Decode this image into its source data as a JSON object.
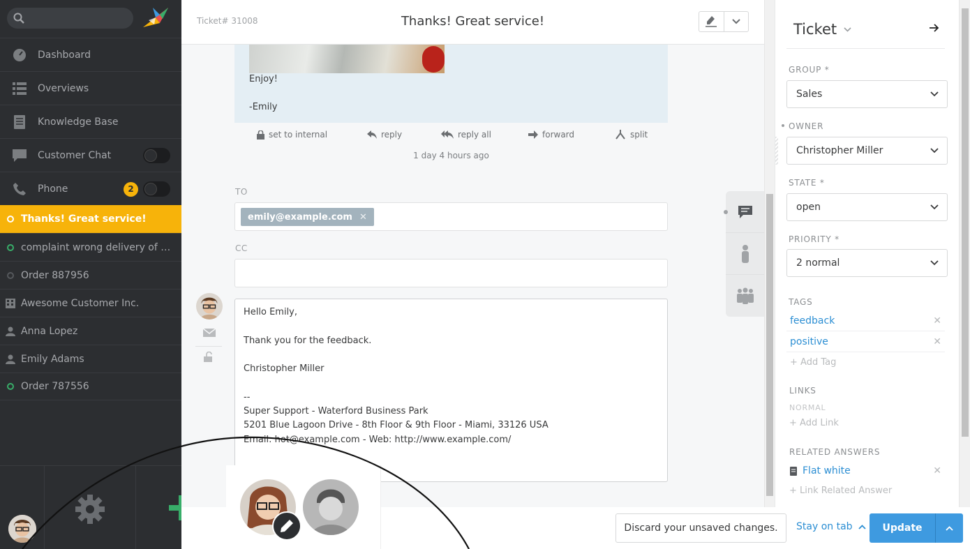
{
  "nav": {
    "items": [
      {
        "label": "Dashboard",
        "icon": "dashboard-icon"
      },
      {
        "label": "Overviews",
        "icon": "list-icon"
      },
      {
        "label": "Knowledge Base",
        "icon": "book-icon"
      },
      {
        "label": "Customer Chat",
        "icon": "chat-icon"
      },
      {
        "label": "Phone",
        "icon": "phone-icon",
        "badge": "2"
      }
    ],
    "tasks": [
      {
        "label": "Thanks! Great service!",
        "icon": "ticket-open-icon",
        "active": true
      },
      {
        "label": "complaint wrong delivery of ord...",
        "icon": "ticket-open-icon"
      },
      {
        "label": "Order 887956",
        "icon": "ticket-closed-icon"
      },
      {
        "label": "Awesome Customer Inc.",
        "icon": "organization-icon"
      },
      {
        "label": "Anna Lopez",
        "icon": "user-icon"
      },
      {
        "label": "Emily Adams",
        "icon": "user-icon"
      },
      {
        "label": "Order 787556",
        "icon": "ticket-open-icon"
      }
    ]
  },
  "ticket": {
    "number": "Ticket# 31008",
    "title": "Thanks! Great service!",
    "article": {
      "line1": "Enjoy!",
      "line2": "-Emily",
      "actions": [
        "set to internal",
        "reply",
        "reply all",
        "forward",
        "split"
      ],
      "time": "1 day 4 hours ago"
    },
    "reply": {
      "to_label": "TO",
      "to_value": "emily@example.com",
      "cc_label": "CC",
      "body": [
        "Hello Emily,",
        "Thank you for the feedback.",
        "Christopher Miller",
        "--",
        "Super Support - Waterford Business Park",
        "5201 Blue Lagoon Drive - 8th Floor & 9th Floor - Miami, 33126 USA",
        "Email: hot@example.com - Web: http://www.example.com/"
      ]
    }
  },
  "bottombar": {
    "discard": "Discard your unsaved changes.",
    "stay": "Stay on tab",
    "update": "Update"
  },
  "sidebar": {
    "title": "Ticket",
    "group_label": "GROUP *",
    "group_value": "Sales",
    "owner_label": "OWNER",
    "owner_value": "Christopher Miller",
    "state_label": "STATE *",
    "state_value": "open",
    "priority_label": "PRIORITY *",
    "priority_value": "2 normal",
    "tags_label": "TAGS",
    "tags": [
      "feedback",
      "positive"
    ],
    "add_tag": "+ Add Tag",
    "links_label": "LINKS",
    "links_normal": "NORMAL",
    "add_link": "+ Add Link",
    "related_label": "RELATED ANSWERS",
    "related": [
      "Flat white"
    ],
    "link_related": "+ Link Related Answer"
  },
  "colors": {
    "accent": "#f7b30a",
    "primary": "#3e9ae0",
    "nav_bg": "#2c2e31",
    "link": "#2b8ed3",
    "online": "#38ad69"
  }
}
